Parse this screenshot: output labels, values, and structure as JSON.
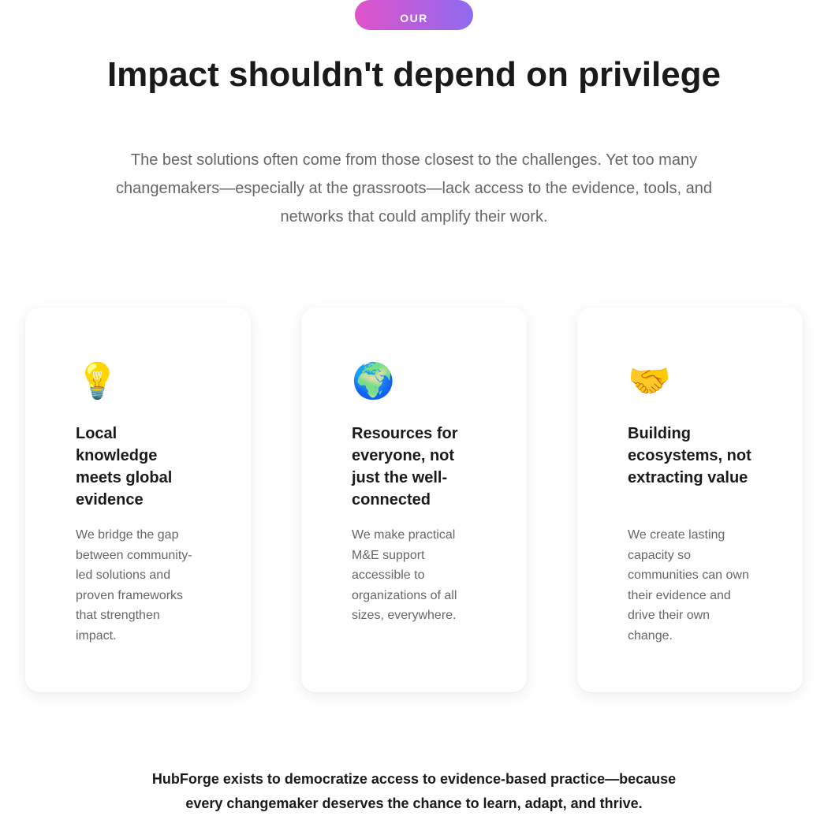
{
  "section": {
    "badge": "OUR PURPOSE",
    "title": "Impact shouldn't depend on privilege",
    "lead": "The best solutions often come from those closest to the challenges. Yet too many changemakers—especially at the grassroots—lack access to the evidence, tools, and networks that could amplify their work."
  },
  "cards": [
    {
      "icon": "💡",
      "icon_name": "lightbulb-icon",
      "title": "Local knowledge meets global evidence",
      "text": "We bridge the gap between community-led solutions and proven frameworks that strengthen impact."
    },
    {
      "icon": "🌍",
      "icon_name": "globe-icon",
      "title": "Resources for everyone, not just the well-connected",
      "text": "We make practical M&E support accessible to organizations of all sizes, everywhere."
    },
    {
      "icon": "🤝",
      "icon_name": "handshake-icon",
      "title": "Building ecosystems, not extracting value",
      "text": "We create lasting capacity so communities can own their evidence and drive their own change."
    }
  ],
  "closing": "HubForge exists to democratize access to evidence-based practice—because every changemaker deserves the chance to learn, adapt, and thrive.",
  "colors": {
    "badge_gradient_start": "#e052c9",
    "badge_gradient_end": "#8f6bf0",
    "heading": "#1a1a1a",
    "body_text": "#666666",
    "background": "#ffffff"
  }
}
